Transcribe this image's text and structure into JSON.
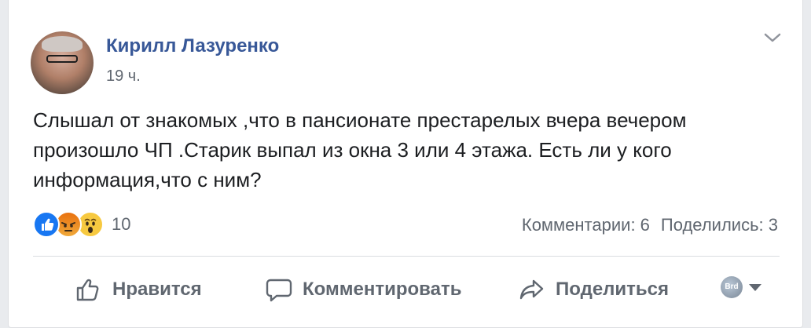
{
  "post": {
    "author": "Кирилл Лазуренко",
    "time": "19 ч.",
    "text_lines": [
      "Слышал от знакомых ,что в пансионате престарелых вчера вечером",
      "произошло ЧП .Старик выпал из окна 3 или 4 этажа. Есть ли у кого",
      "информация,что с ним?"
    ]
  },
  "reactions": {
    "icons": [
      "like-icon",
      "angry-icon",
      "wow-icon"
    ],
    "count": "10"
  },
  "stats": {
    "comments": "Комментарии: 6",
    "shares": "Поделились: 3"
  },
  "actions": {
    "like": "Нравится",
    "comment": "Комментировать",
    "share": "Поделиться"
  },
  "audience": {
    "avatar_text": "Brd"
  },
  "colors": {
    "author": "#385898",
    "secondary_text": "#606770",
    "like_blue": "#1877f2",
    "divider": "#dadde1"
  }
}
